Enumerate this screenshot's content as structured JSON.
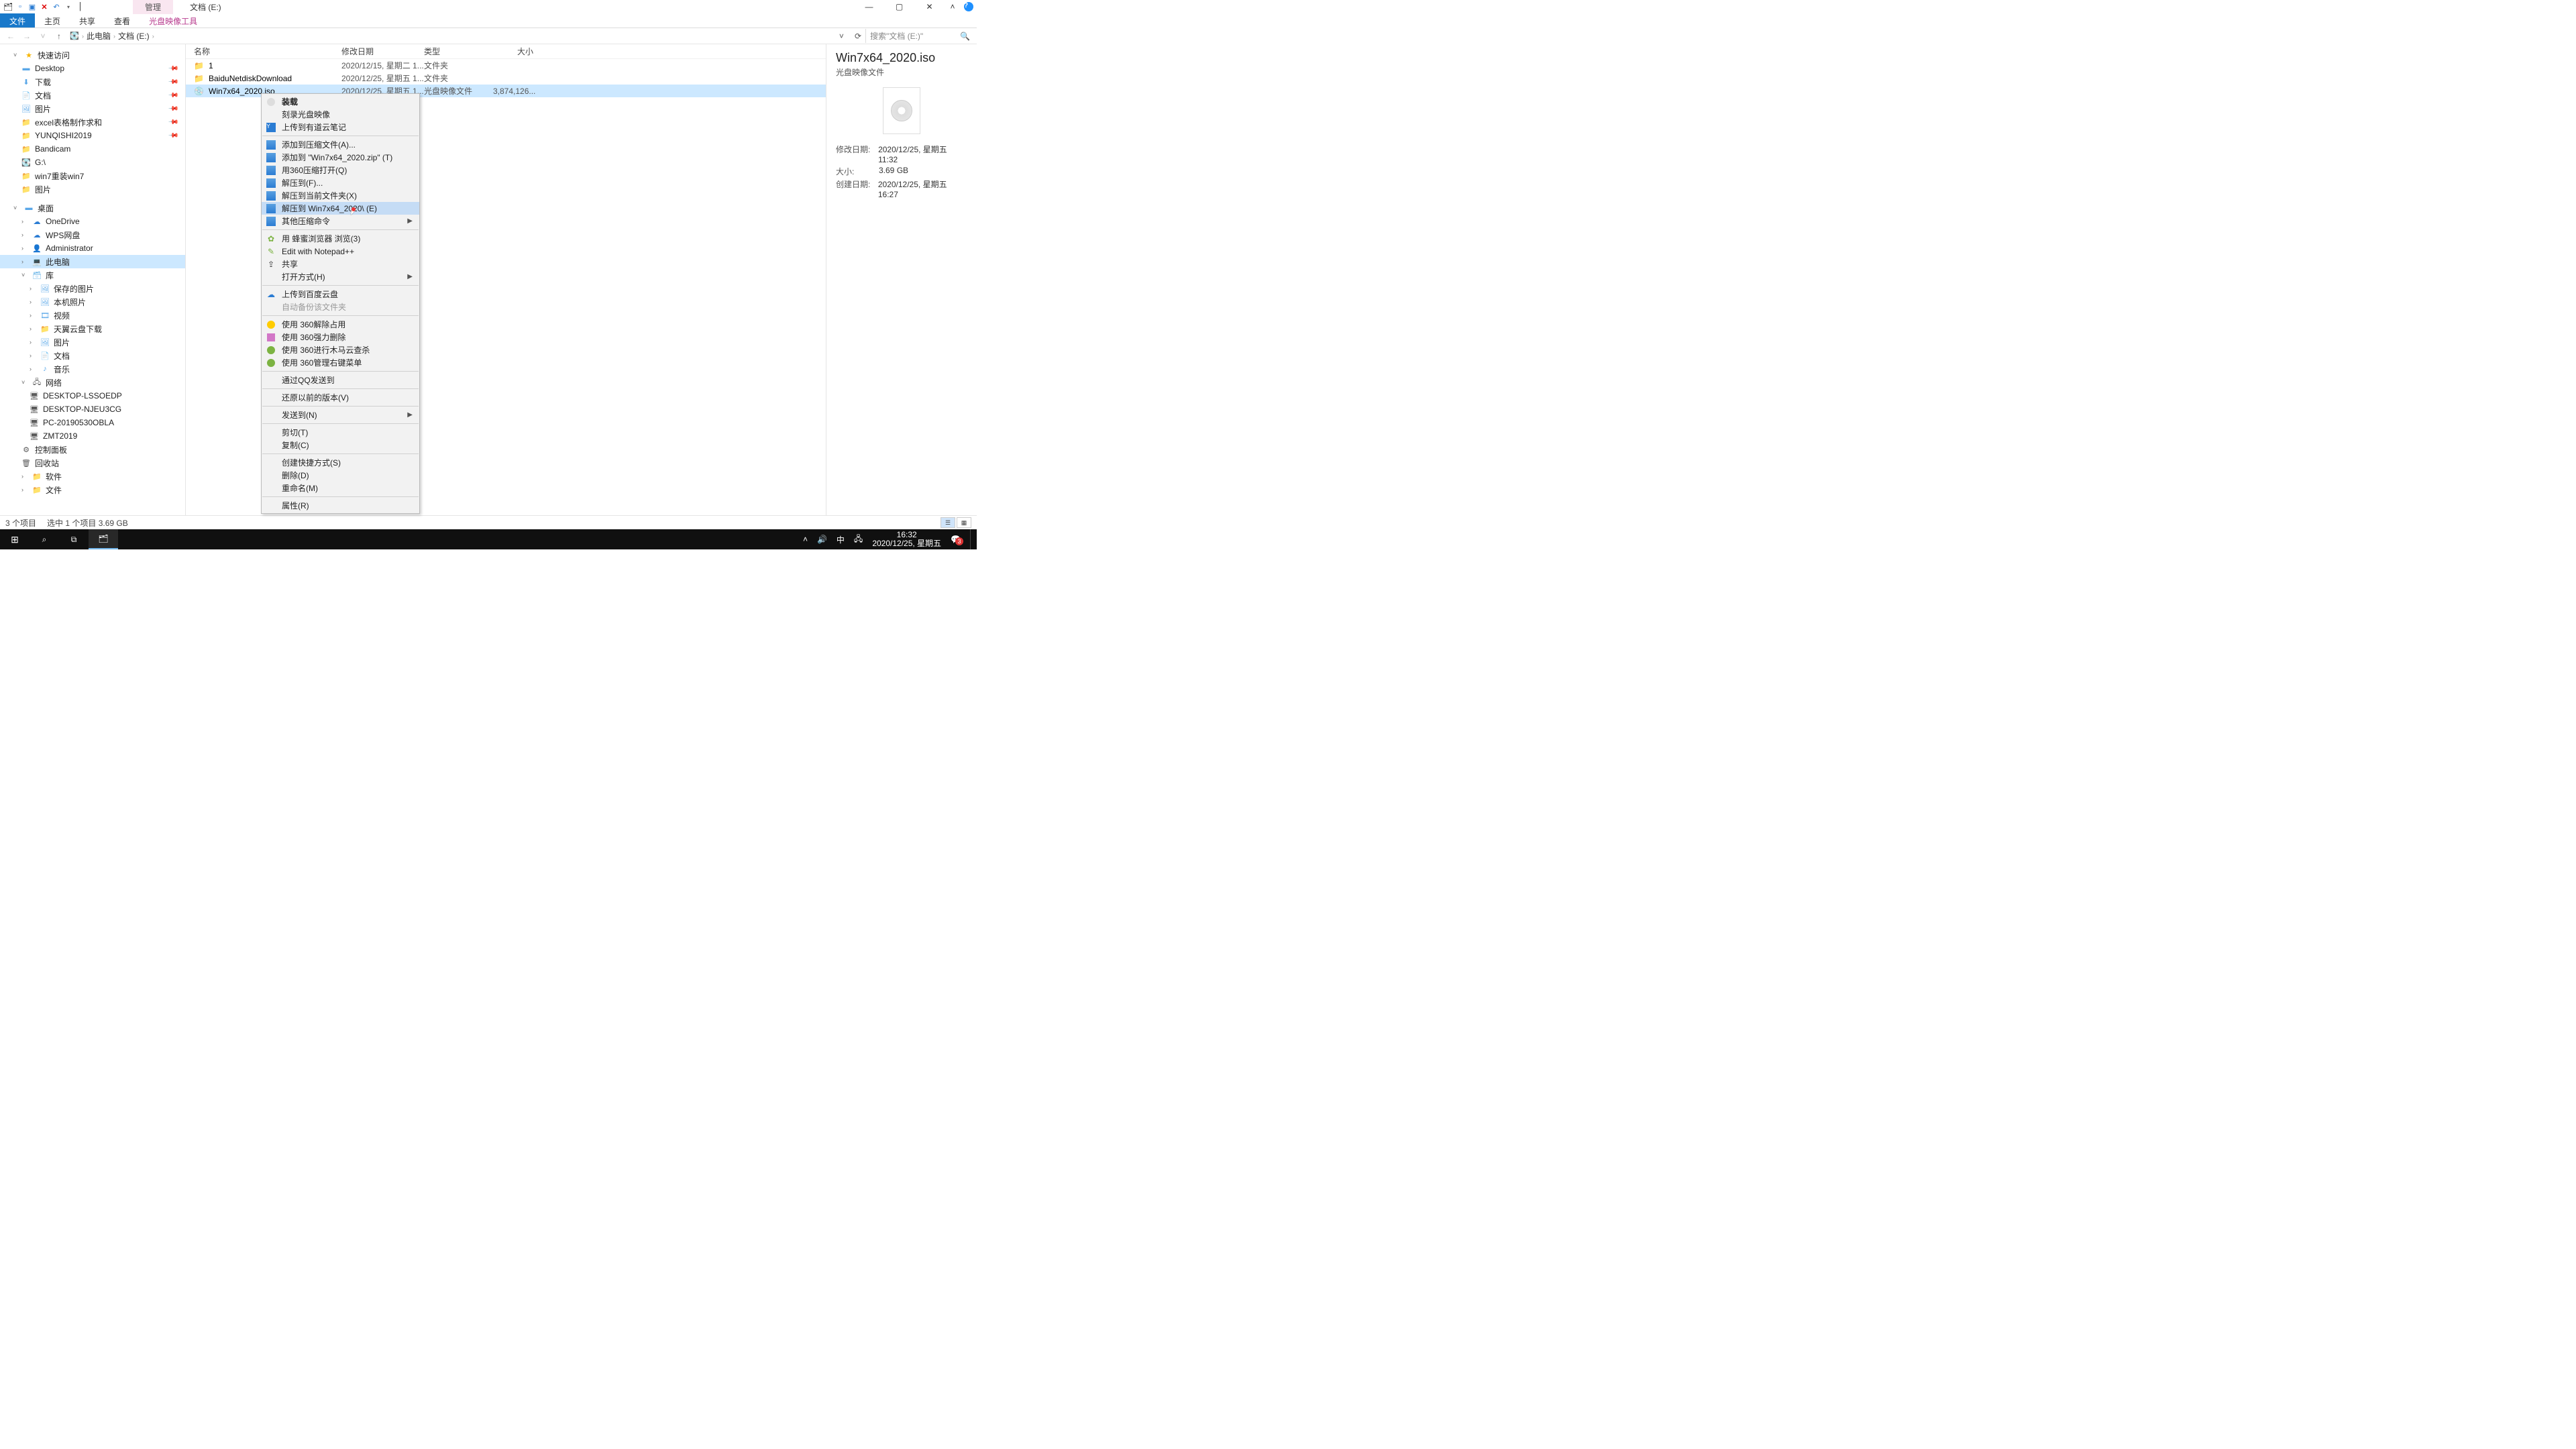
{
  "window": {
    "ribbon_context": "管理",
    "title": "文档 (E:)",
    "tabs": {
      "file": "文件",
      "home": "主页",
      "share": "共享",
      "view": "查看",
      "tool": "光盘映像工具"
    }
  },
  "address": {
    "segments": [
      "此电脑",
      "文档 (E:)"
    ],
    "search_placeholder": "搜索\"文档 (E:)\""
  },
  "nav": {
    "quick": "快速访问",
    "quick_items": [
      "Desktop",
      "下载",
      "文档",
      "图片",
      "excel表格制作求和",
      "YUNQISHI2019",
      "Bandicam",
      "G:\\",
      "win7重装win7",
      "图片"
    ],
    "desktop": "桌面",
    "desktop_items": [
      "OneDrive",
      "WPS网盘",
      "Administrator",
      "此电脑",
      "库"
    ],
    "lib_items": [
      "保存的图片",
      "本机照片",
      "视频",
      "天翼云盘下载",
      "图片",
      "文档",
      "音乐"
    ],
    "network": "网络",
    "net_items": [
      "DESKTOP-LSSOEDP",
      "DESKTOP-NJEU3CG",
      "PC-20190530OBLA",
      "ZMT2019"
    ],
    "tail": [
      "控制面板",
      "回收站",
      "软件",
      "文件"
    ]
  },
  "columns": {
    "name": "名称",
    "date": "修改日期",
    "type": "类型",
    "size": "大小"
  },
  "rows": [
    {
      "name": "1",
      "date": "2020/12/15, 星期二 1...",
      "type": "文件夹",
      "size": ""
    },
    {
      "name": "BaiduNetdiskDownload",
      "date": "2020/12/25, 星期五 1...",
      "type": "文件夹",
      "size": ""
    },
    {
      "name": "Win7x64_2020.iso",
      "date": "2020/12/25, 星期五 1...",
      "type": "光盘映像文件",
      "size": "3,874,126..."
    }
  ],
  "context_menu": {
    "groups": [
      [
        {
          "label": "装载",
          "bold": true,
          "icon": "disc"
        },
        {
          "label": "刻录光盘映像"
        },
        {
          "label": "上传到有道云笔记",
          "icon": "ynote"
        }
      ],
      [
        {
          "label": "添加到压缩文件(A)...",
          "icon": "zip"
        },
        {
          "label": "添加到 \"Win7x64_2020.zip\" (T)",
          "icon": "zip"
        },
        {
          "label": "用360压缩打开(Q)",
          "icon": "zip"
        },
        {
          "label": "解压到(F)...",
          "icon": "zip"
        },
        {
          "label": "解压到当前文件夹(X)",
          "icon": "zip"
        },
        {
          "label": "解压到 Win7x64_2020\\ (E)",
          "icon": "zip",
          "hov": true
        },
        {
          "label": "其他压缩命令",
          "icon": "zip",
          "sub": true
        }
      ],
      [
        {
          "label": "用 蜂蜜浏览器 浏览(3)",
          "icon": "bee"
        },
        {
          "label": "Edit with Notepad++",
          "icon": "npp"
        },
        {
          "label": "共享",
          "icon": "share"
        },
        {
          "label": "打开方式(H)",
          "sub": true
        }
      ],
      [
        {
          "label": "上传到百度云盘",
          "icon": "bd"
        },
        {
          "label": "自动备份该文件夹",
          "dis": true
        }
      ],
      [
        {
          "label": "使用 360解除占用",
          "icon": "360"
        },
        {
          "label": "使用 360强力删除",
          "icon": "360b"
        },
        {
          "label": "使用 360进行木马云查杀",
          "icon": "360c"
        },
        {
          "label": "使用 360管理右键菜单",
          "icon": "360c"
        }
      ],
      [
        {
          "label": "通过QQ发送到"
        }
      ],
      [
        {
          "label": "还原以前的版本(V)"
        }
      ],
      [
        {
          "label": "发送到(N)",
          "sub": true
        }
      ],
      [
        {
          "label": "剪切(T)"
        },
        {
          "label": "复制(C)"
        }
      ],
      [
        {
          "label": "创建快捷方式(S)"
        },
        {
          "label": "删除(D)"
        },
        {
          "label": "重命名(M)"
        }
      ],
      [
        {
          "label": "属性(R)"
        }
      ]
    ]
  },
  "preview": {
    "title": "Win7x64_2020.iso",
    "subtitle": "光盘映像文件",
    "meta": [
      {
        "k": "修改日期:",
        "v": "2020/12/25, 星期五 11:32"
      },
      {
        "k": "大小:",
        "v": "3.69 GB"
      },
      {
        "k": "创建日期:",
        "v": "2020/12/25, 星期五 16:27"
      }
    ]
  },
  "status": {
    "count": "3 个项目",
    "selection": "选中 1 个项目  3.69 GB"
  },
  "taskbar": {
    "ime": "中",
    "time": "16:32",
    "date": "2020/12/25, 星期五",
    "badge": "3"
  }
}
